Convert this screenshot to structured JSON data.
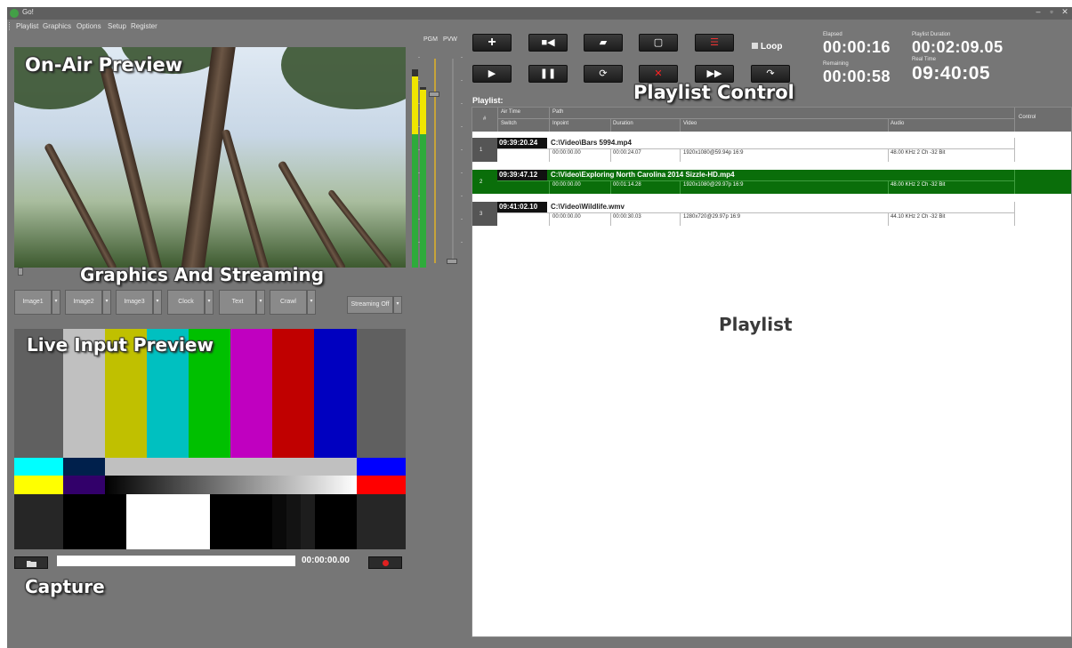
{
  "window": {
    "title": "Go!",
    "controls": [
      "–",
      "▫",
      "✕"
    ]
  },
  "menu": [
    "Playlist",
    "Graphics",
    "Options",
    "Setup",
    "Register"
  ],
  "overlays": {
    "on_air": "On-Air Preview",
    "graphics": "Graphics And Streaming",
    "live": "Live Input Preview",
    "capture": "Capture",
    "playlist_control": "Playlist Control",
    "playlist": "Playlist"
  },
  "meters": {
    "pgm": "PGM",
    "pvw": "PVW"
  },
  "graphics_buttons": [
    "Image1",
    "Image2",
    "Image3",
    "Clock",
    "Text",
    "Crawl"
  ],
  "streaming": "Streaming Off",
  "capture": {
    "time": "00:00:00.00"
  },
  "transport": {
    "loop": "Loop",
    "elapsed_label": "Elapsed",
    "elapsed": "00:00:16",
    "remaining_label": "Remaining",
    "remaining": "00:00:58",
    "duration_label": "Playlist Duration",
    "duration": "00:02:09.05",
    "realtime_label": "Real Time",
    "realtime": "09:40:05"
  },
  "playlist": {
    "label": "Playlist:",
    "headers": {
      "num": "#",
      "air_time": "Air Time",
      "switch": "Switch",
      "path": "Path",
      "inpoint": "Inpoint",
      "duration": "Duration",
      "video": "Video",
      "audio": "Audio",
      "control": "Control"
    },
    "rows": [
      {
        "num": "1",
        "air": "09:39:20.24",
        "path": "C:\\Video\\Bars 5994.mp4",
        "inpoint": "00:00:00.00",
        "duration": "00:00:24.07",
        "video": "1920x1080@59.94p 16:9",
        "audio": "48.00 KHz 2 Ch -32 Bit",
        "active": false
      },
      {
        "num": "2",
        "air": "09:39:47.12",
        "path": "C:\\Video\\Exploring North Carolina 2014 Sizzle-HD.mp4",
        "inpoint": "00:00:00.00",
        "duration": "00:01:14.28",
        "video": "1920x1080@29.97p 16:9",
        "audio": "48.00 KHz 2 Ch -32 Bit",
        "active": true
      },
      {
        "num": "3",
        "air": "09:41:02.10",
        "path": "C:\\Video\\Wildlife.wmv",
        "inpoint": "00:00:00.00",
        "duration": "00:00:30.03",
        "video": "1280x720@29.97p 16:9",
        "audio": "44.10 KHz 2 Ch -32 Bit",
        "active": false
      }
    ]
  }
}
